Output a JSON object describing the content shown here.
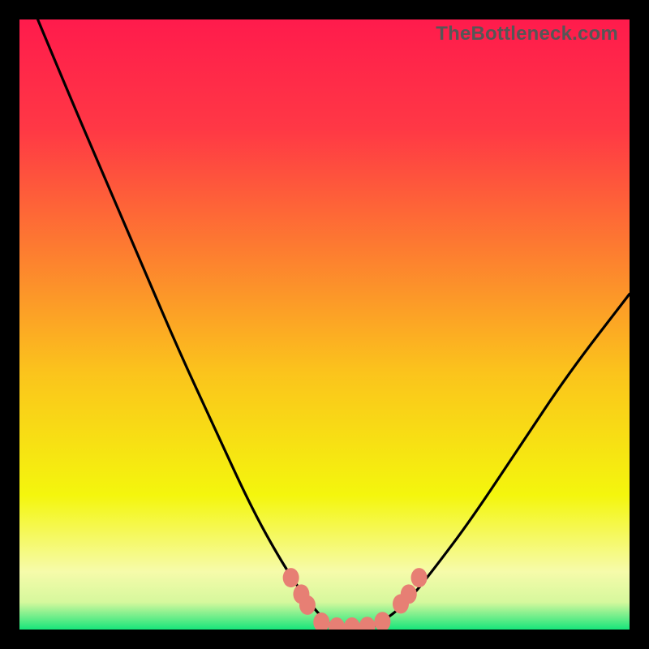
{
  "watermark": "TheBottleneck.com",
  "chart_data": {
    "type": "line",
    "title": "",
    "xlabel": "",
    "ylabel": "",
    "xlim": [
      0,
      100
    ],
    "ylim": [
      0,
      100
    ],
    "series": [
      {
        "name": "left-curve",
        "x": [
          3,
          8,
          14,
          20,
          26,
          32,
          38,
          43,
          47,
          50,
          52
        ],
        "y": [
          100,
          88,
          74,
          60,
          46,
          33,
          20,
          11,
          5,
          1.5,
          0
        ]
      },
      {
        "name": "right-curve",
        "x": [
          57,
          60,
          64,
          68,
          74,
          82,
          90,
          100
        ],
        "y": [
          0,
          1.5,
          5,
          10,
          18,
          30,
          42,
          55
        ]
      }
    ],
    "markers": {
      "name": "salmon-points",
      "color": "#e77f74",
      "points": [
        {
          "x": 44.5,
          "y": 8.5
        },
        {
          "x": 46.2,
          "y": 5.8
        },
        {
          "x": 47.2,
          "y": 4.0
        },
        {
          "x": 49.5,
          "y": 1.2
        },
        {
          "x": 52.0,
          "y": 0.4
        },
        {
          "x": 54.5,
          "y": 0.4
        },
        {
          "x": 57.0,
          "y": 0.5
        },
        {
          "x": 59.5,
          "y": 1.3
        },
        {
          "x": 62.5,
          "y": 4.2
        },
        {
          "x": 63.8,
          "y": 5.8
        },
        {
          "x": 65.5,
          "y": 8.5
        }
      ]
    },
    "background_gradient": {
      "stops": [
        {
          "offset": 0.0,
          "color": "#ff1b4c"
        },
        {
          "offset": 0.18,
          "color": "#ff3845"
        },
        {
          "offset": 0.38,
          "color": "#fd7d30"
        },
        {
          "offset": 0.58,
          "color": "#fbc41c"
        },
        {
          "offset": 0.78,
          "color": "#f4f60d"
        },
        {
          "offset": 0.905,
          "color": "#f6fbaa"
        },
        {
          "offset": 0.955,
          "color": "#d6f89d"
        },
        {
          "offset": 1.0,
          "color": "#17e57b"
        }
      ]
    }
  }
}
